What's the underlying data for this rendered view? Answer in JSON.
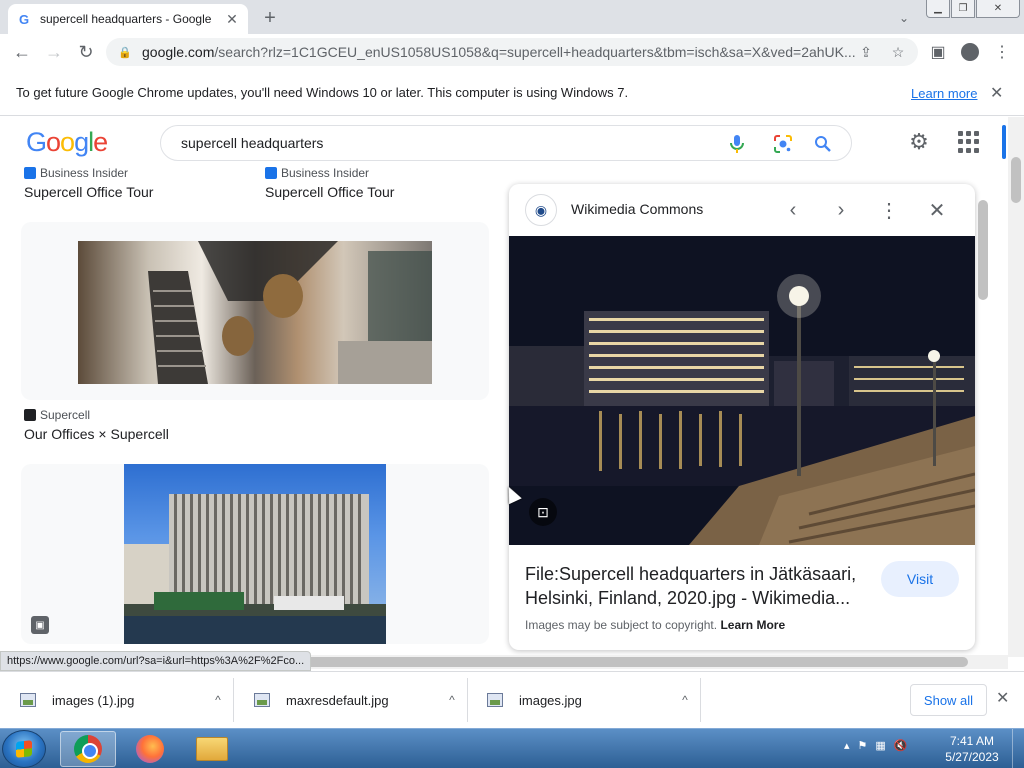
{
  "browser": {
    "tab_title": "supercell headquarters - Google",
    "tab_favicon": "G",
    "url_main": "google.com",
    "url_rest": "/search?rlz=1C1GCEU_enUS1058US1058&q=supercell+headquarters&tbm=isch&sa=X&ved=2ahUK...",
    "status_url": "https://www.google.com/url?sa=i&url=https%3A%2F%2Fco..."
  },
  "infobar": {
    "message": "To get future Google Chrome updates, you'll need Windows 10 or later. This computer is using Windows 7.",
    "learn_more": "Learn more"
  },
  "google": {
    "query": "supercell headquarters"
  },
  "results": [
    {
      "source": "Business Insider",
      "title": "Supercell Office Tour"
    },
    {
      "source": "Business Insider",
      "title": "Supercell Office Tour"
    },
    {
      "source": "Supercell",
      "title": "Our Offices × Supercell"
    }
  ],
  "panel": {
    "site": "Wikimedia Commons",
    "title": "File:Supercell headquarters in Jätkäsaari, Helsinki, Finland, 2020.jpg - Wikimedia...",
    "visit_label": "Visit",
    "copyright_text": "Images may be subject to copyright.",
    "copyright_link": "Learn More"
  },
  "downloads": {
    "items": [
      {
        "name": "images (1).jpg"
      },
      {
        "name": "maxresdefault.jpg"
      },
      {
        "name": "images.jpg"
      }
    ],
    "show_all": "Show all"
  },
  "taskbar": {
    "time": "7:41 AM",
    "date": "5/27/2023"
  },
  "colors": {
    "accent": "#1a73e8",
    "google_blue": "#4285f4",
    "google_red": "#ea4335",
    "google_yellow": "#fbbc05",
    "google_green": "#34a853"
  }
}
